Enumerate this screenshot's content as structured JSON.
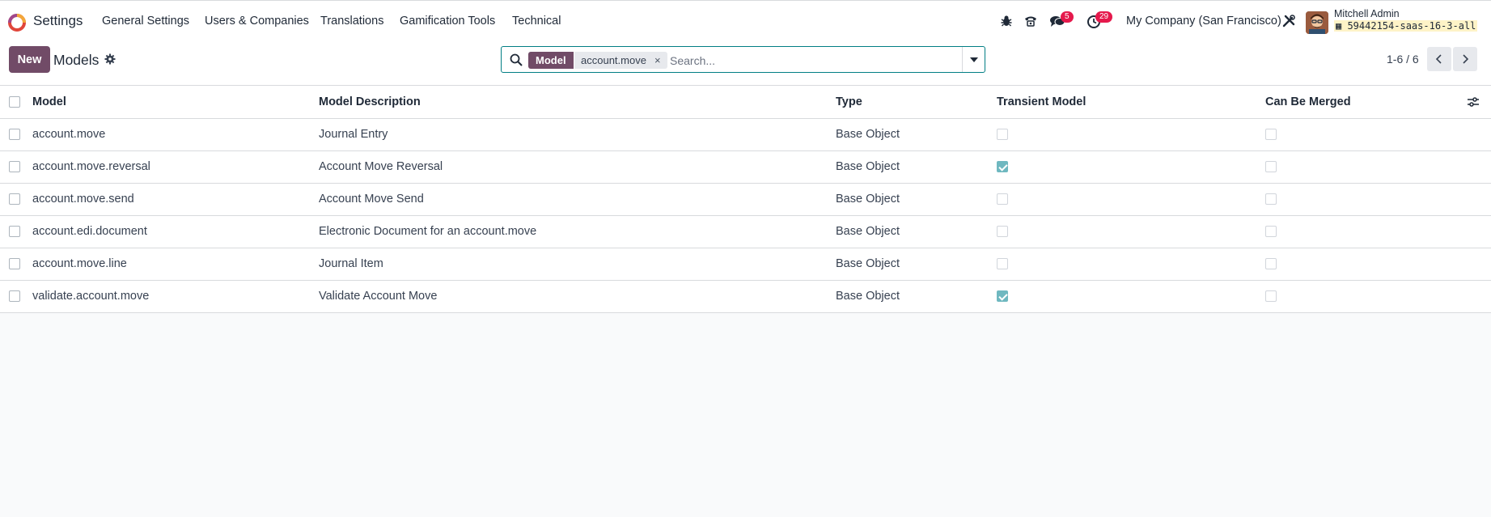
{
  "app": {
    "name": "Settings",
    "menu": [
      "General Settings",
      "Users & Companies",
      "Translations",
      "Gamification Tools",
      "Technical"
    ]
  },
  "systray": {
    "messages_count": "5",
    "activities_count": "29",
    "company": "My Company (San Francisco)",
    "user_name": "Mitchell Admin",
    "db_name": "59442154-saas-16-3-all"
  },
  "control": {
    "new_label": "New",
    "title": "Models",
    "search": {
      "facet_label": "Model",
      "facet_value": "account.move",
      "facet_remove": "×",
      "placeholder": "Search..."
    },
    "pager": "1-6 / 6"
  },
  "table": {
    "columns": [
      "Model",
      "Model Description",
      "Type",
      "Transient Model",
      "Can Be Merged"
    ],
    "rows": [
      {
        "model": "account.move",
        "description": "Journal Entry",
        "type": "Base Object",
        "transient": false,
        "mergeable": false
      },
      {
        "model": "account.move.reversal",
        "description": "Account Move Reversal",
        "type": "Base Object",
        "transient": true,
        "mergeable": false
      },
      {
        "model": "account.move.send",
        "description": "Account Move Send",
        "type": "Base Object",
        "transient": false,
        "mergeable": false
      },
      {
        "model": "account.edi.document",
        "description": "Electronic Document for an account.move",
        "type": "Base Object",
        "transient": false,
        "mergeable": false
      },
      {
        "model": "account.move.line",
        "description": "Journal Item",
        "type": "Base Object",
        "transient": false,
        "mergeable": false
      },
      {
        "model": "validate.account.move",
        "description": "Validate Account Move",
        "type": "Base Object",
        "transient": true,
        "mergeable": false
      }
    ]
  },
  "icons": {
    "brand": "odoo-logo-icon",
    "debug": "bug-icon",
    "phone": "phone-icon",
    "messages": "chat-icon",
    "activities": "clock-icon",
    "tools": "tools-icon",
    "search": "search-icon",
    "dropdown": "caret-down-icon",
    "pager_prev": "chevron-left-icon",
    "pager_next": "chevron-right-icon",
    "gear": "gear-icon",
    "optional_columns": "sliders-icon"
  },
  "colors": {
    "primary": "#714b67",
    "accent": "#017e84",
    "badge": "#e5194c",
    "checked": "#6fb8c0"
  }
}
